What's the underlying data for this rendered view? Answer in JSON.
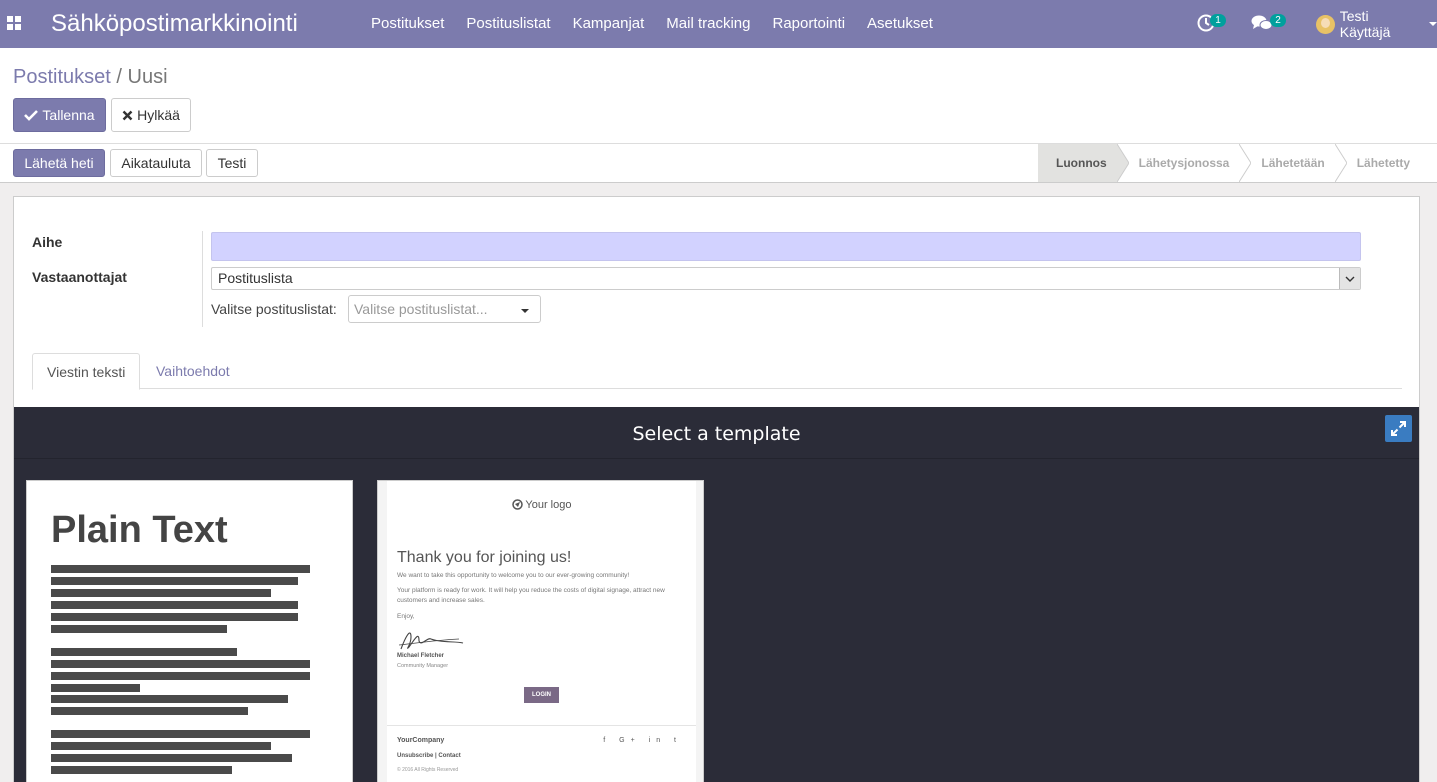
{
  "navbar": {
    "app_title": "Sähköpostimarkkinointi",
    "menu": [
      "Postitukset",
      "Postituslistat",
      "Kampanjat",
      "Mail tracking",
      "Raportointi",
      "Asetukset"
    ],
    "activity_count": "1",
    "messages_count": "2",
    "user_name": "Testi Käyttäjä",
    "accent": "#7c7bad",
    "badge_color": "#00a09d"
  },
  "breadcrumb": {
    "parent": "Postitukset",
    "separator": "/",
    "current": "Uusi"
  },
  "actions": {
    "save": "Tallenna",
    "discard": "Hylkää"
  },
  "header_buttons": {
    "send_now": "Lähetä heti",
    "schedule": "Aikatauluta",
    "test": "Testi"
  },
  "statusbar": {
    "stages": [
      "Luonnos",
      "Lähetysjonossa",
      "Lähetetään",
      "Lähetetty"
    ],
    "active_stage": "Luonnos"
  },
  "form": {
    "subject_label": "Aihe",
    "subject_value": "",
    "recipients_label": "Vastaanottajat",
    "recipients_value": "Postituslista",
    "mailing_lists_label": "Valitse postituslistat:",
    "mailing_lists_placeholder": "Valitse postituslistat..."
  },
  "tabs": {
    "body": "Viestin teksti",
    "options": "Vaihtoehdot"
  },
  "template_chooser": {
    "title": "Select a template",
    "plain_text": {
      "title": "Plain Text"
    },
    "welcome": {
      "logo": "Your logo",
      "heading": "Thank you for joining us!",
      "p1": "We want to take this opportunity to welcome you to our ever-growing community!",
      "p2": "Your platform is ready for work. It will help you reduce the costs of digital signage, attract new customers and increase sales.",
      "p3": "Enjoy,",
      "signer": "Michael Fletcher",
      "signer_role": "Community Manager",
      "button": "LOGIN",
      "company": "YourCompany",
      "links": "Unsubscribe | Contact",
      "rights": "© 2016 All Rights Reserved",
      "social": "f G+ in t"
    }
  }
}
